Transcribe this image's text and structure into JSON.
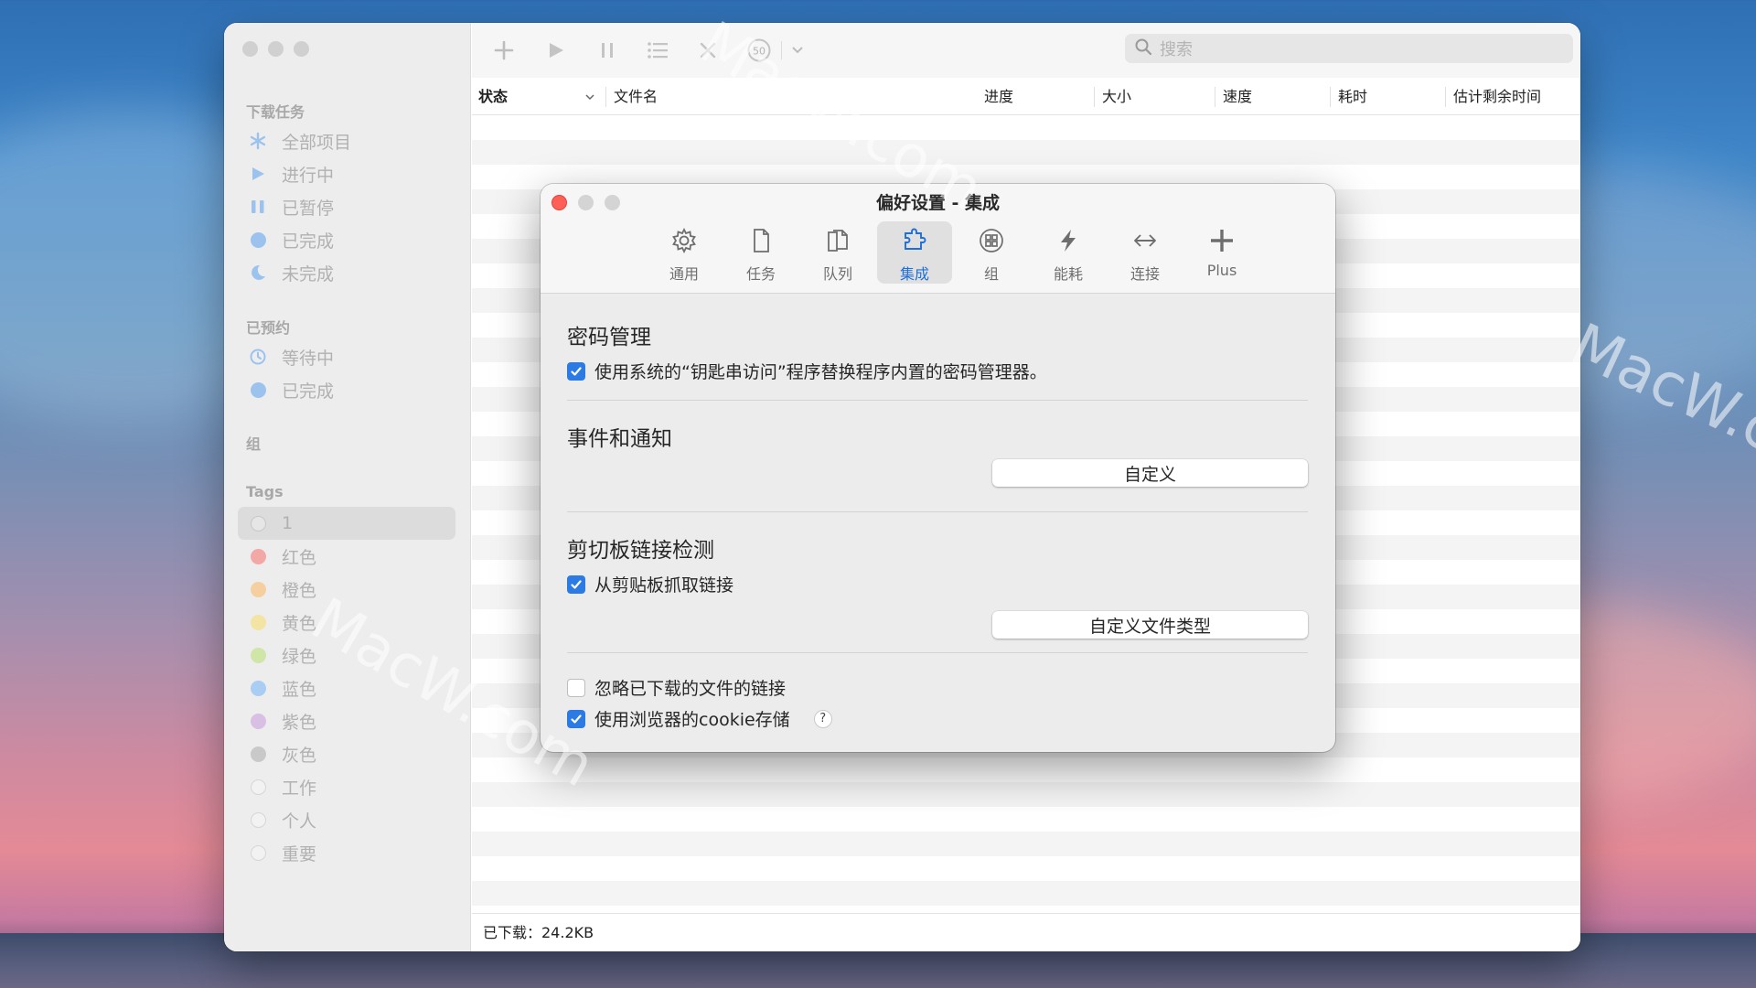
{
  "watermark": {
    "text": "MacW.com",
    "partial": "MacW.c"
  },
  "window": {
    "lights": [
      "close",
      "minimize",
      "zoom"
    ],
    "sidebar": {
      "sections": [
        {
          "title": "下载任务",
          "items": [
            {
              "label": "全部项目",
              "icon": "asterisk-icon"
            },
            {
              "label": "进行中",
              "icon": "play-icon"
            },
            {
              "label": "已暂停",
              "icon": "pause-icon"
            },
            {
              "label": "已完成",
              "icon": "filled-circle-icon"
            },
            {
              "label": "未完成",
              "icon": "moon-icon"
            }
          ]
        },
        {
          "title": "已预约",
          "items": [
            {
              "label": "等待中",
              "icon": "clock-icon"
            },
            {
              "label": "已完成",
              "icon": "filled-circle-icon"
            }
          ]
        },
        {
          "title": "组",
          "items": []
        },
        {
          "title": "Tags",
          "items": [
            {
              "label": "1",
              "color": "#e6e6e6",
              "selected": true
            },
            {
              "label": "红色",
              "color": "#f2a9a6"
            },
            {
              "label": "橙色",
              "color": "#f5cfa0"
            },
            {
              "label": "黄色",
              "color": "#f3e4a3"
            },
            {
              "label": "绿色",
              "color": "#cfe6a8"
            },
            {
              "label": "蓝色",
              "color": "#a9cdf3"
            },
            {
              "label": "紫色",
              "color": "#d9bfe3"
            },
            {
              "label": "灰色",
              "color": "#c9c9c9"
            },
            {
              "label": "工作",
              "color": "#f2f2f2"
            },
            {
              "label": "个人",
              "color": "#f2f2f2"
            },
            {
              "label": "重要",
              "color": "#f2f2f2"
            }
          ]
        }
      ]
    },
    "toolbar": {
      "icons": [
        "plus-icon",
        "play-icon",
        "pause-icon",
        "list-icon",
        "close-icon",
        "speed-limit-icon",
        "chevron-down-icon"
      ],
      "speed_value": "50",
      "search_placeholder": "搜索"
    },
    "columns": [
      "状态",
      "文件名",
      "进度",
      "大小",
      "速度",
      "耗时",
      "估计剩余时间"
    ],
    "status_bar": "已下载：24.2KB"
  },
  "dialog": {
    "title": "偏好设置 - 集成",
    "tabs": [
      {
        "label": "通用",
        "icon": "gear-icon"
      },
      {
        "label": "任务",
        "icon": "document-icon"
      },
      {
        "label": "队列",
        "icon": "stack-icon"
      },
      {
        "label": "集成",
        "icon": "puzzle-icon",
        "active": true
      },
      {
        "label": "组",
        "icon": "group-icon"
      },
      {
        "label": "能耗",
        "icon": "bolt-icon"
      },
      {
        "label": "连接",
        "icon": "arrows-icon"
      },
      {
        "label": "Plus",
        "icon": "plus-icon"
      }
    ],
    "password": {
      "heading": "密码管理",
      "checkbox": "使用系统的“钥匙串访问”程序替换程序内置的密码管理器。",
      "checked": true
    },
    "events": {
      "heading": "事件和通知",
      "button": "自定义"
    },
    "clipboard": {
      "heading": "剪切板链接检测",
      "checkbox": "从剪贴板抓取链接",
      "checked": true,
      "button": "自定义文件类型"
    },
    "ignore": {
      "label": "忽略已下载的文件的链接",
      "checked": false
    },
    "cookie": {
      "label": "使用浏览器的cookie存储",
      "checked": true,
      "help": "?"
    }
  }
}
